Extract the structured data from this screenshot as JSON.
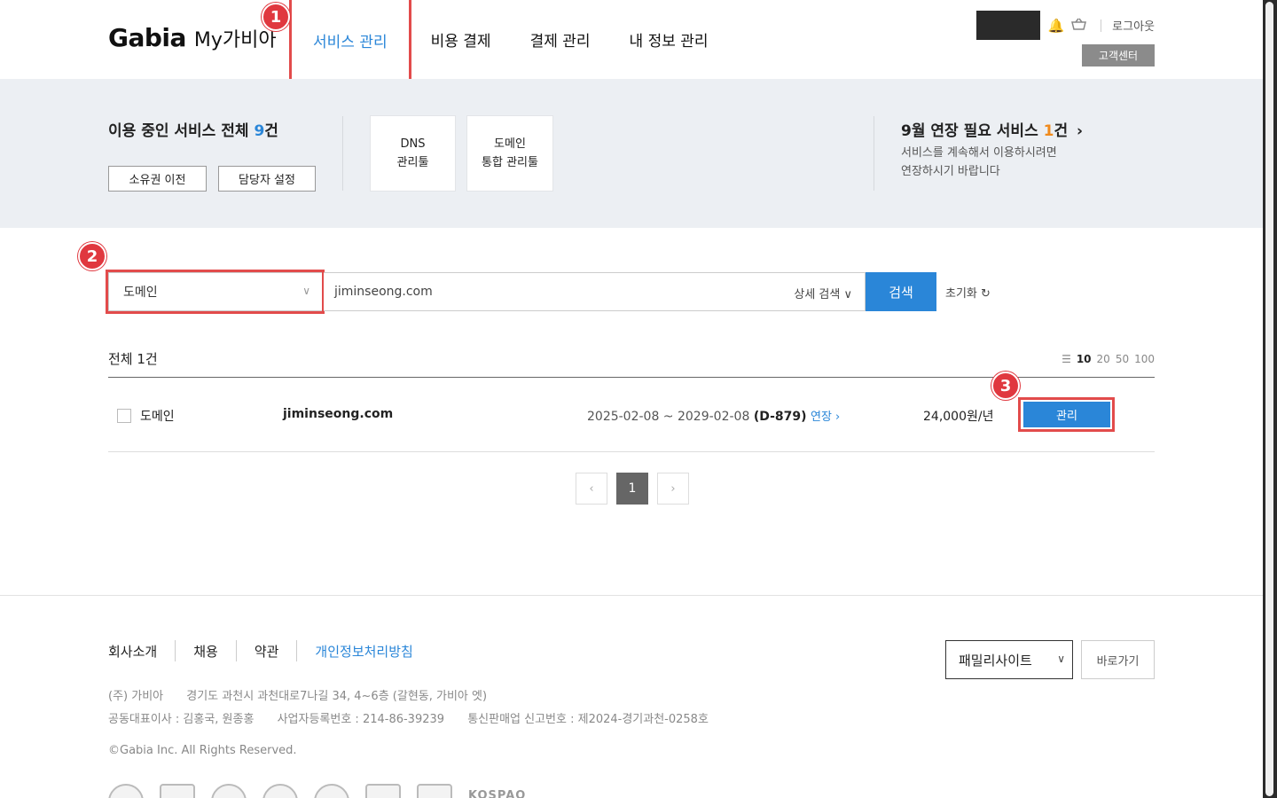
{
  "header": {
    "brand": "Gabia",
    "sub": "My가비아",
    "nav": [
      {
        "label": "서비스 관리"
      },
      {
        "label": "비용 결제"
      },
      {
        "label": "결제 관리"
      },
      {
        "label": "내 정보 관리"
      }
    ],
    "logout": "로그아웃",
    "customer_center": "고객센터"
  },
  "annotations": [
    "1",
    "2",
    "3"
  ],
  "summary": {
    "title_prefix": "이용 중인 서비스 전체 ",
    "count": "9",
    "title_suffix": "건",
    "transfer_btn": "소유권 이전",
    "manager_btn": "담당자 설정",
    "tools": [
      {
        "line1": "DNS",
        "line2": "관리툴"
      },
      {
        "line1": "도메인",
        "line2": "통합 관리툴"
      }
    ],
    "renew_prefix": "9월 연장 필요 서비스 ",
    "renew_count": "1",
    "renew_suffix": "건",
    "renew_desc1": "서비스를 계속해서 이용하시려면",
    "renew_desc2": "연장하시기 바랍니다"
  },
  "search": {
    "category": "도메인",
    "query": "jiminseong.com",
    "advanced": "상세 검색",
    "button": "검색",
    "reset": "초기화"
  },
  "list": {
    "total": "전체 1건",
    "page_sizes": [
      "10",
      "20",
      "50",
      "100"
    ],
    "rows": [
      {
        "type": "도메인",
        "name": "jiminseong.com",
        "period": "2025-02-08 ~ 2029-02-08",
        "dday": "(D-879)",
        "renew": "연장",
        "price": "24,000원/년",
        "manage": "관리"
      }
    ]
  },
  "pager": {
    "current": "1"
  },
  "footer": {
    "links": [
      "회사소개",
      "채용",
      "약관",
      "개인정보처리방침"
    ],
    "family": "패밀리사이트",
    "goto": "바로가기",
    "company": "(주) 가비아",
    "address": "경기도 과천시 과천대로7나길 34, 4~6층 (갈현동, 가비아 엣)",
    "ceo": "공동대표이사 : 김홍국, 원종홍",
    "bizno": "사업자등록번호 : 214-86-39239",
    "mailorder": "통신판매업 신고번호 : 제2024-경기과천-0258호",
    "copyright": "©Gabia Inc. All Rights Reserved.",
    "cert_text": "KOSPAO"
  }
}
